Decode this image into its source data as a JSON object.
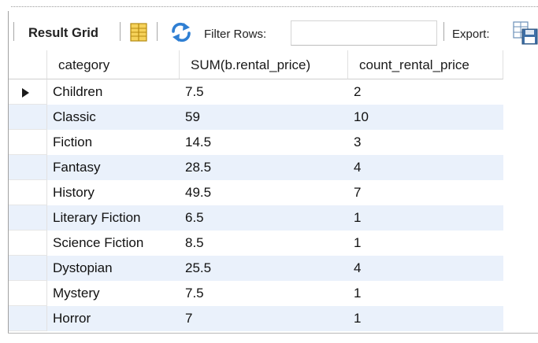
{
  "toolbar": {
    "result_grid_label": "Result Grid",
    "grid_icon": "form-grid-icon",
    "refresh_icon": "refresh-icon",
    "filter_label": "Filter Rows:",
    "filter_value": "",
    "export_label": "Export:",
    "export_icon": "export-icon"
  },
  "grid": {
    "columns": [
      "category",
      "SUM(b.rental_price)",
      "count_rental_price"
    ],
    "rows": [
      [
        "Children",
        "7.5",
        "2"
      ],
      [
        "Classic",
        "59",
        "10"
      ],
      [
        "Fiction",
        "14.5",
        "3"
      ],
      [
        "Fantasy",
        "28.5",
        "4"
      ],
      [
        "History",
        "49.5",
        "7"
      ],
      [
        "Literary Fiction",
        "6.5",
        "1"
      ],
      [
        "Science Fiction",
        "8.5",
        "1"
      ],
      [
        "Dystopian",
        "25.5",
        "4"
      ],
      [
        "Mystery",
        "7.5",
        "1"
      ],
      [
        "Horror",
        "7",
        "1"
      ]
    ],
    "selected_row": 0,
    "alt_row_color": "#eaf1fb"
  }
}
